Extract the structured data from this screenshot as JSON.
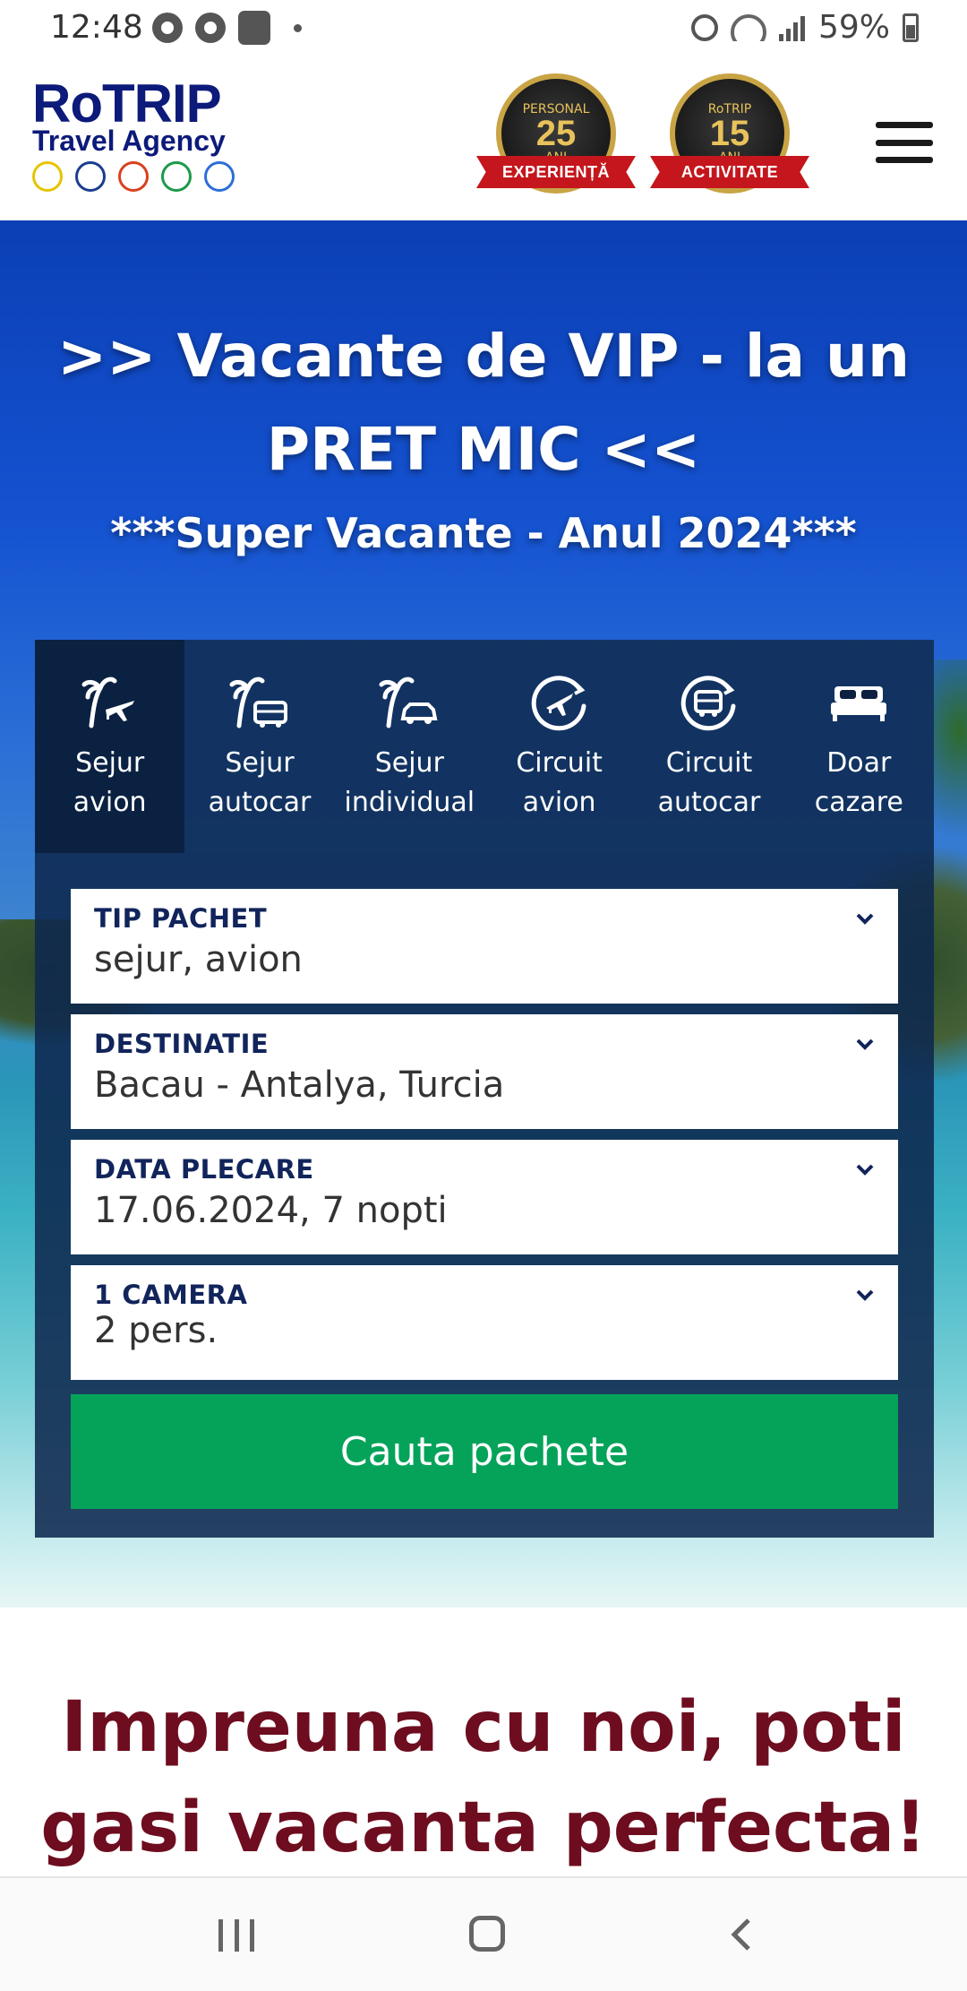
{
  "status_bar": {
    "time": "12:48",
    "battery": "59%",
    "icons_left": [
      "chrome-icon",
      "chrome-icon",
      "app-plus-icon",
      "notification-dot"
    ],
    "icons_right": [
      "alarm-icon",
      "wifi-icon",
      "signal-icon",
      "battery-icon"
    ]
  },
  "header": {
    "logo_word": "RoTRIP",
    "logo_sub": "Travel Agency",
    "logo_icon_colors": [
      "#e6c400",
      "#1c3d8f",
      "#d9411e",
      "#1b9b49",
      "#2c6fd6"
    ],
    "badges": [
      {
        "top": "PERSONAL",
        "number": "25",
        "unit": "ANI",
        "ribbon": "EXPERIENȚĂ"
      },
      {
        "top": "RoTRIP",
        "number": "15",
        "unit": "ANI",
        "ribbon": "ACTIVITATE"
      }
    ],
    "menu_icon": "hamburger-menu-icon"
  },
  "hero": {
    "title": ">> Vacante de VIP - la un PRET MIC <<",
    "subtitle": "***Super Vacante - Anul 2024***"
  },
  "search": {
    "tabs": [
      {
        "label": "Sejur\navion",
        "icon": "palm-plane-icon",
        "active": true
      },
      {
        "label": "Sejur\nautocar",
        "icon": "palm-bus-icon",
        "active": false
      },
      {
        "label": "Sejur\nindividual",
        "icon": "palm-car-icon",
        "active": false
      },
      {
        "label": "Circuit\navion",
        "icon": "circuit-plane-icon",
        "active": false
      },
      {
        "label": "Circuit\nautocar",
        "icon": "circuit-bus-icon",
        "active": false
      },
      {
        "label": "Doar\ncazare",
        "icon": "bed-icon",
        "active": false
      }
    ],
    "fields": [
      {
        "label": "TIP PACHET",
        "value": "sejur, avion"
      },
      {
        "label": "DESTINATIE",
        "value": "Bacau - Antalya, Turcia"
      },
      {
        "label": "DATA PLECARE",
        "value": "17.06.2024, 7 nopti"
      },
      {
        "label": "1 CAMERA",
        "value": "2 pers."
      }
    ],
    "button": "Cauta pachete",
    "button_color": "#05a35a"
  },
  "promo": {
    "text": "Impreuna cu noi, poti gasi vacanta perfecta!",
    "color": "#6e0d1f"
  },
  "nav_bar": {
    "buttons": [
      "recents-icon",
      "home-icon",
      "back-icon"
    ]
  }
}
